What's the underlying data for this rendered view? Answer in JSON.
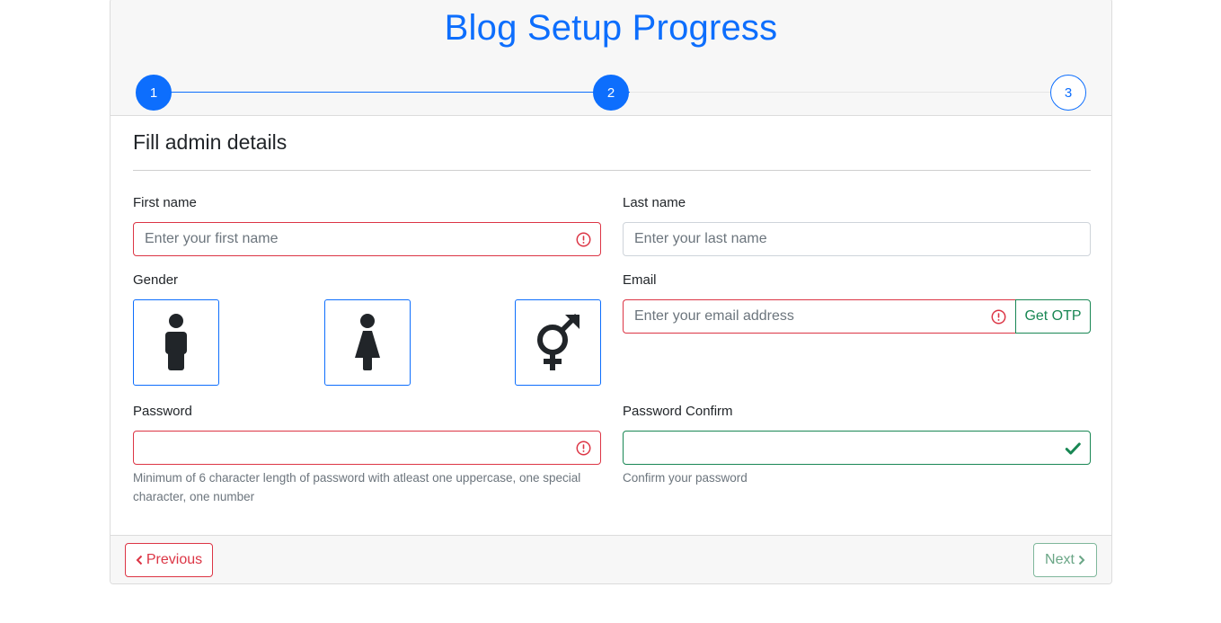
{
  "header": {
    "title": "Blog Setup Progress",
    "steps": [
      {
        "label": "1",
        "state": "complete"
      },
      {
        "label": "2",
        "state": "current"
      },
      {
        "label": "3",
        "state": "pending"
      }
    ]
  },
  "form": {
    "section_title": "Fill admin details",
    "first_name": {
      "label": "First name",
      "placeholder": "Enter your first name",
      "value": "",
      "status": "invalid"
    },
    "last_name": {
      "label": "Last name",
      "placeholder": "Enter your last name",
      "value": "",
      "status": "neutral"
    },
    "gender": {
      "label": "Gender",
      "options": [
        {
          "icon": "male-icon"
        },
        {
          "icon": "female-icon"
        },
        {
          "icon": "transgender-icon"
        }
      ]
    },
    "email": {
      "label": "Email",
      "placeholder": "Enter your email address",
      "value": "",
      "status": "invalid",
      "otp_label": "Get OTP"
    },
    "password": {
      "label": "Password",
      "value": "",
      "status": "invalid",
      "help": "Minimum of 6 character length of password with atleast one uppercase, one special character, one number"
    },
    "password_confirm": {
      "label": "Password Confirm",
      "value": "",
      "status": "valid",
      "help": "Confirm your password"
    }
  },
  "footer": {
    "previous_label": "Previous",
    "next_label": "Next"
  },
  "colors": {
    "primary": "#0d6efd",
    "danger": "#dc3545",
    "success": "#198754"
  }
}
